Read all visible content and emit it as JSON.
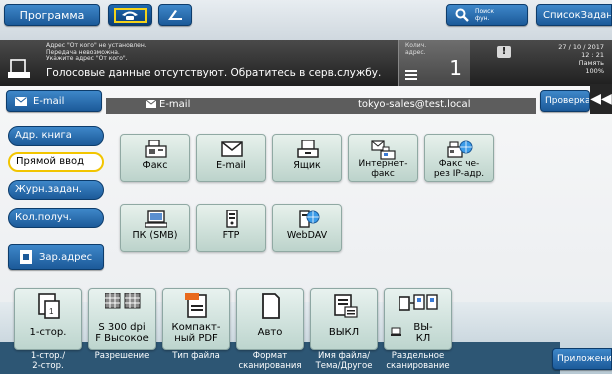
{
  "topbar": {
    "program_label": "Программа",
    "search_label_line1": "Поиск",
    "search_label_line2": "фун.",
    "joblist_label": "СписокЗаданий"
  },
  "message_panel": {
    "lines": [
      "Адрес \"От кого\" не установлен.",
      "Передача невозможна.",
      "Укажите адрес \"От кого\"."
    ],
    "main_text": "Голосовые данные отсутствуют. Обратитесь в серв.службу.",
    "qty_label_line1": "Колич.",
    "qty_label_line2": "адрес.",
    "qty_value": "1",
    "alert_glyph": "!",
    "date": "27 / 10 / 2017",
    "time": "12 : 21",
    "memory_label": "Память",
    "memory_value": "100%"
  },
  "destination": {
    "tab_label": "E-mail",
    "addr_type": "E-mail",
    "addr_value": "tokyo-sales@test.local",
    "check_button": "Проверка",
    "collapse_glyph": "◀◀"
  },
  "nav": {
    "address_book": "Адр. книга",
    "direct_input": "Прямой ввод",
    "job_history": "Журн.задан.",
    "multi_dest": "Кол.получ.",
    "register_address": "Зар.адрес",
    "active": "direct_input"
  },
  "dest_types": [
    {
      "label": "Факс",
      "icon": "fax-icon"
    },
    {
      "label": "E-mail",
      "icon": "envelope-icon"
    },
    {
      "label": "Ящик",
      "icon": "box-icon"
    },
    {
      "label": "Интернет-\nфакс",
      "icon": "internet-fax-icon"
    },
    {
      "label": "Факс че-\nрез IP-адр.",
      "icon": "ip-fax-icon"
    },
    {
      "label": "ПК (SMB)",
      "icon": "computer-icon"
    },
    {
      "label": "FTP",
      "icon": "ftp-icon"
    },
    {
      "label": "WebDAV",
      "icon": "webdav-icon"
    }
  ],
  "settings": [
    {
      "value": "1-стор.",
      "caption": "1-стор./\n2-стор."
    },
    {
      "value": "S 300 dpi\nF Высокое",
      "caption": "Разрешение"
    },
    {
      "value": "Компакт-\nный PDF",
      "caption": "Тип файла"
    },
    {
      "value": "Авто",
      "caption": "Формат\nсканирования"
    },
    {
      "value": "ВЫКЛ",
      "caption": "Имя файла/\nТема/Другое"
    },
    {
      "value": "ВЫ-\nКЛ",
      "caption": "Раздельное\nсканирование"
    }
  ],
  "apps_button": "Приложение",
  "colors": {
    "button_blue": "#1c5a99",
    "active_outline": "#f2c500",
    "dest_button_bg": "#c9ddd6",
    "bottom_bar": "#2d5674"
  }
}
